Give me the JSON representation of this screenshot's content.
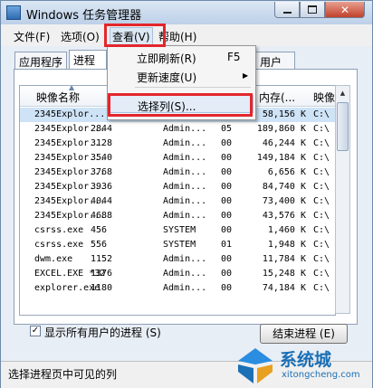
{
  "window": {
    "title": "Windows 任务管理器"
  },
  "menubar": {
    "file": "文件(F)",
    "options": "选项(O)",
    "view": "查看(V)",
    "help": "帮助(H)"
  },
  "tabs": {
    "apps": "应用程序",
    "processes": "进程",
    "users": "用户"
  },
  "dropdown": {
    "refresh": {
      "label": "立即刷新(R)",
      "shortcut": "F5"
    },
    "update_speed": "更新速度(U)",
    "select_columns": "选择列(S)..."
  },
  "list": {
    "headers": {
      "image": "映像名称",
      "memory": "内存(...",
      "desc": "映像"
    },
    "rows": [
      {
        "image": "2345Explor...",
        "pid": "",
        "user": "",
        "cpu": "",
        "mem": "58,156 K",
        "desc": "C:\\"
      },
      {
        "image": "2345Explor...",
        "pid": "2844",
        "user": "Admin...",
        "cpu": "05",
        "mem": "189,860 K",
        "desc": "C:\\"
      },
      {
        "image": "2345Explor...",
        "pid": "3128",
        "user": "Admin...",
        "cpu": "00",
        "mem": "46,244 K",
        "desc": "C:\\"
      },
      {
        "image": "2345Explor...",
        "pid": "3540",
        "user": "Admin...",
        "cpu": "00",
        "mem": "149,184 K",
        "desc": "C:\\"
      },
      {
        "image": "2345Explor...",
        "pid": "3768",
        "user": "Admin...",
        "cpu": "00",
        "mem": "6,656 K",
        "desc": "C:\\"
      },
      {
        "image": "2345Explor...",
        "pid": "3936",
        "user": "Admin...",
        "cpu": "00",
        "mem": "84,740 K",
        "desc": "C:\\"
      },
      {
        "image": "2345Explor...",
        "pid": "4044",
        "user": "Admin...",
        "cpu": "00",
        "mem": "73,400 K",
        "desc": "C:\\"
      },
      {
        "image": "2345Explor...",
        "pid": "4688",
        "user": "Admin...",
        "cpu": "00",
        "mem": "43,576 K",
        "desc": "C:\\"
      },
      {
        "image": "csrss.exe",
        "pid": "456",
        "user": "SYSTEM",
        "cpu": "00",
        "mem": "1,460 K",
        "desc": "C:\\"
      },
      {
        "image": "csrss.exe",
        "pid": "556",
        "user": "SYSTEM",
        "cpu": "01",
        "mem": "1,948 K",
        "desc": "C:\\"
      },
      {
        "image": "dwm.exe",
        "pid": "1152",
        "user": "Admin...",
        "cpu": "00",
        "mem": "11,784 K",
        "desc": "C:\\"
      },
      {
        "image": "EXCEL.EXE *32",
        "pid": "1376",
        "user": "Admin...",
        "cpu": "00",
        "mem": "15,248 K",
        "desc": "C:\\"
      },
      {
        "image": "explorer.exe",
        "pid": "1180",
        "user": "Admin...",
        "cpu": "00",
        "mem": "74,184 K",
        "desc": "C:\\"
      }
    ]
  },
  "show_all": {
    "label": "显示所有用户的进程 (S)",
    "checked": "✓"
  },
  "end_process": "结束进程 (E)",
  "statusbar": {
    "text": "选择进程页中可见的列"
  },
  "watermark": {
    "name": "系统城",
    "url": "xitongcheng.com"
  },
  "colors": {
    "highlight_red": "#e3262d",
    "brand_blue": "#1b6fb5"
  }
}
